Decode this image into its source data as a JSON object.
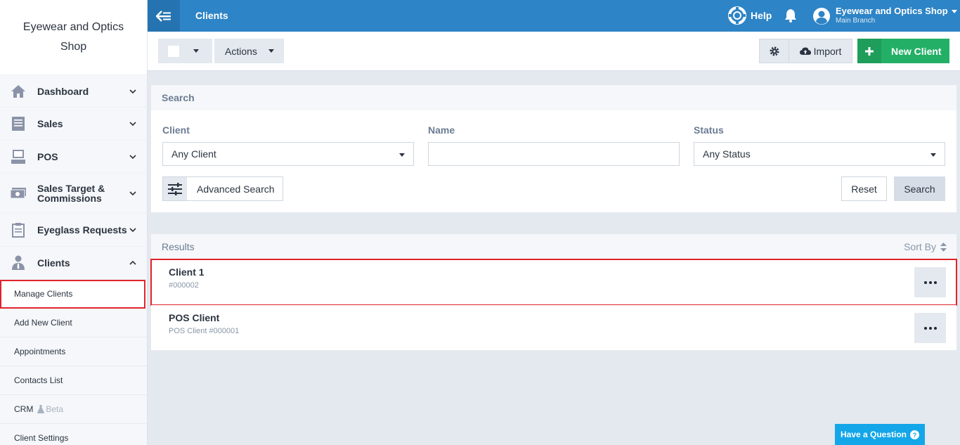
{
  "sidebar": {
    "brand": "Eyewear and Optics Shop",
    "items": [
      {
        "label": "Dashboard"
      },
      {
        "label": "Sales"
      },
      {
        "label": "POS"
      },
      {
        "label": "Sales Target & Commissions"
      },
      {
        "label": "Eyeglass Requests"
      },
      {
        "label": "Clients"
      }
    ],
    "sub_items": [
      {
        "label": "Manage Clients"
      },
      {
        "label": "Add New Client"
      },
      {
        "label": "Appointments"
      },
      {
        "label": "Contacts List"
      },
      {
        "label": "CRM",
        "badge": "Beta"
      },
      {
        "label": "Client Settings"
      }
    ]
  },
  "topbar": {
    "title": "Clients",
    "help": "Help",
    "account_name": "Eyewear and Optics Shop",
    "branch": "Main Branch"
  },
  "toolbar": {
    "actions": "Actions",
    "import": "Import",
    "new_client": "New Client"
  },
  "search": {
    "title": "Search",
    "client_label": "Client",
    "client_value": "Any Client",
    "name_label": "Name",
    "name_value": "",
    "status_label": "Status",
    "status_value": "Any Status",
    "advanced": "Advanced Search",
    "reset": "Reset",
    "search": "Search"
  },
  "results": {
    "title": "Results",
    "sort_by": "Sort By",
    "rows": [
      {
        "name": "Client 1",
        "sub": "#000002"
      },
      {
        "name": "POS Client",
        "sub": "POS Client #000001"
      }
    ]
  },
  "help_widget": "Have a Question",
  "colors": {
    "topbar": "#2d84c6",
    "accent_green": "#23b066",
    "highlight": "#e0242b",
    "help_widget": "#13a6e8"
  }
}
